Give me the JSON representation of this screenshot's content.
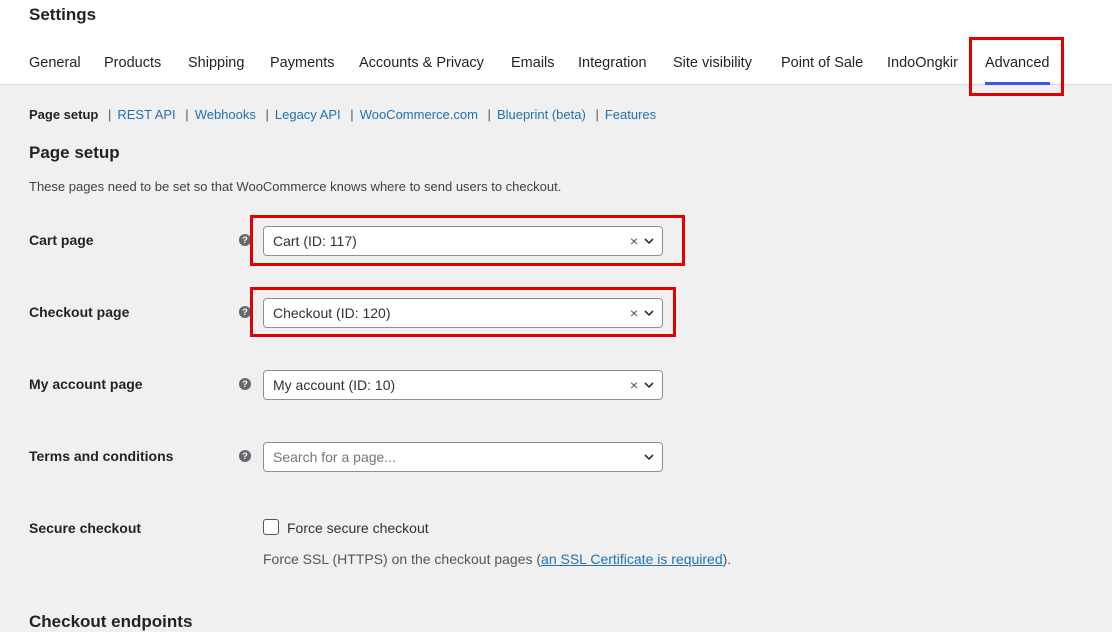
{
  "page_title": "Settings",
  "tabs": [
    {
      "label": "General"
    },
    {
      "label": "Products"
    },
    {
      "label": "Shipping"
    },
    {
      "label": "Payments"
    },
    {
      "label": "Accounts & Privacy"
    },
    {
      "label": "Emails"
    },
    {
      "label": "Integration"
    },
    {
      "label": "Site visibility"
    },
    {
      "label": "Point of Sale"
    },
    {
      "label": "IndoOngkir"
    },
    {
      "label": "Advanced",
      "active": true
    }
  ],
  "subnav": {
    "current": "Page setup",
    "links": [
      "REST API",
      "Webhooks",
      "Legacy API",
      "WooCommerce.com",
      "Blueprint (beta)",
      "Features"
    ],
    "separator": "|"
  },
  "section": {
    "title": "Page setup",
    "description": "These pages need to be set so that WooCommerce knows where to send users to checkout."
  },
  "fields": {
    "cart": {
      "label": "Cart page",
      "value": "Cart (ID: 117)",
      "help": "?",
      "clear": "×"
    },
    "checkout": {
      "label": "Checkout page",
      "value": "Checkout (ID: 120)",
      "help": "?",
      "clear": "×"
    },
    "myaccount": {
      "label": "My account page",
      "value": "My account (ID: 10)",
      "help": "?",
      "clear": "×"
    },
    "terms": {
      "label": "Terms and conditions",
      "placeholder": "Search for a page...",
      "help": "?"
    },
    "secure": {
      "label": "Secure checkout",
      "checkbox_label": "Force secure checkout",
      "checked": false,
      "note_before": "Force SSL (HTTPS) on the checkout pages (",
      "note_link": "an SSL Certificate is required",
      "note_after": ")."
    }
  },
  "next_section_title": "Checkout endpoints",
  "colors": {
    "accent": "#3858e9",
    "highlight": "#e00000",
    "link": "#2271b1",
    "background": "#f0f0f1"
  },
  "icons": [
    "help-icon",
    "clear-icon",
    "chevron-down-icon"
  ]
}
